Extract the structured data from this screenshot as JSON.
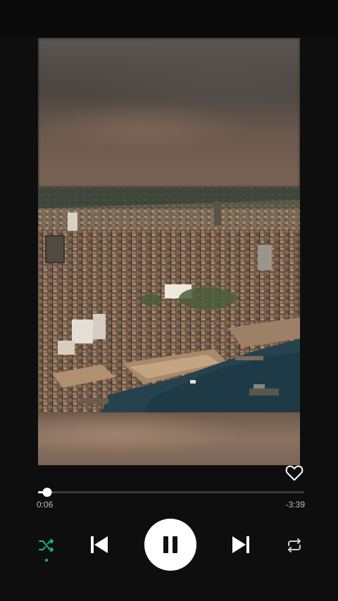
{
  "player": {
    "elapsed": "0:06",
    "remaining": "-3:39",
    "progress_fraction": 0.035,
    "shuffle_active": true,
    "accent_color": "#1db97a",
    "is_playing": true
  },
  "icons": {
    "like": "heart-outline-icon",
    "shuffle": "shuffle-icon",
    "previous": "skip-previous-icon",
    "play_pause": "pause-icon",
    "next": "skip-next-icon",
    "repeat": "repeat-icon"
  }
}
